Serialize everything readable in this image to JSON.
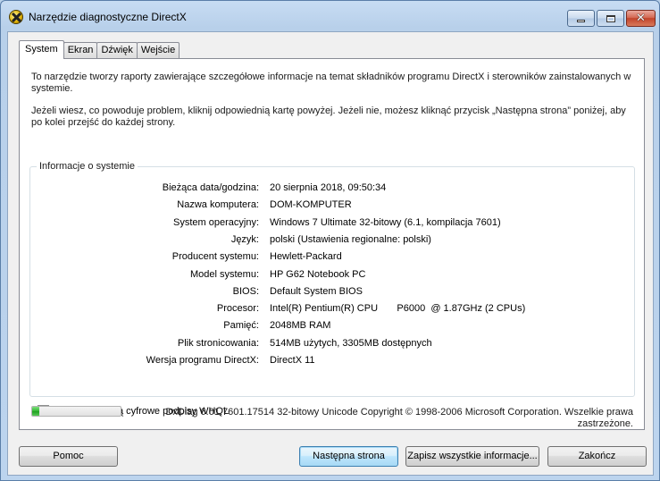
{
  "window": {
    "title": "Narzędzie diagnostyczne DirectX"
  },
  "tabs": [
    {
      "label": "System",
      "active": true
    },
    {
      "label": "Ekran",
      "active": false
    },
    {
      "label": "Dźwięk",
      "active": false
    },
    {
      "label": "Wejście",
      "active": false
    }
  ],
  "intro": {
    "paragraph1": "To narzędzie tworzy raporty zawierające szczegółowe informacje na temat składników programu DirectX i sterowników zainstalowanych w systemie.",
    "paragraph2": "Jeżeli wiesz, co powoduje problem, kliknij odpowiednią kartę powyżej. Jeżeli nie, możesz kliknąć przycisk „Następna strona” poniżej, aby po kolei przejść do każdej strony."
  },
  "system_info": {
    "group_title": "Informacje o systemie",
    "rows": [
      {
        "label": "Bieżąca data/godzina:",
        "value": "20 sierpnia 2018, 09:50:34"
      },
      {
        "label": "Nazwa komputera:",
        "value": "DOM-KOMPUTER"
      },
      {
        "label": "System operacyjny:",
        "value": "Windows 7 Ultimate 32-bitowy (6.1, kompilacja 7601)"
      },
      {
        "label": "Język:",
        "value": "polski (Ustawienia regionalne: polski)"
      },
      {
        "label": "Producent systemu:",
        "value": "Hewlett-Packard"
      },
      {
        "label": "Model systemu:",
        "value": "HP G62 Notebook PC"
      },
      {
        "label": "BIOS:",
        "value": "Default System BIOS"
      },
      {
        "label": "Procesor:",
        "value": "Intel(R) Pentium(R) CPU       P6000  @ 1.87GHz (2 CPUs)"
      },
      {
        "label": "Pamięć:",
        "value": "2048MB RAM"
      },
      {
        "label": "Plik stronicowania:",
        "value": "514MB użytych, 3305MB dostępnych"
      },
      {
        "label": "Wersja programu DirectX:",
        "value": "DirectX 11"
      }
    ]
  },
  "whql_check": {
    "label": "Sprawdź, czy są cyfrowe podpisy WHQL",
    "checked": true
  },
  "progress": {
    "fraction": 0.08
  },
  "status_text": "DxDiag 6.01.7601.17514 32-bitowy Unicode  Copyright © 1998-2006 Microsoft Corporation. Wszelkie prawa zastrzeżone.",
  "buttons": {
    "help": "Pomoc",
    "next": "Następna strona",
    "save_all": "Zapisz wszystkie informacje...",
    "exit": "Zakończ"
  }
}
